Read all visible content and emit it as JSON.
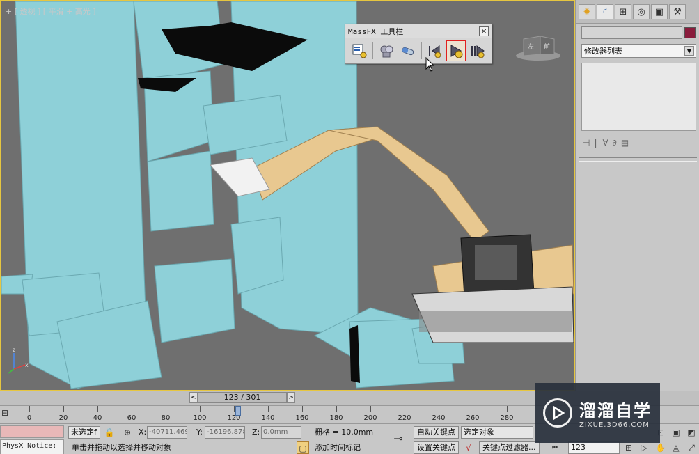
{
  "viewport": {
    "label": "+ [ 透视 ] [ 平滑 + 高光 ]"
  },
  "massfx": {
    "title": "MassFX 工具栏",
    "close": "×",
    "tools": [
      {
        "icon": "massfx-explorer-icon"
      },
      {
        "icon": "rigid-body-icon"
      },
      {
        "icon": "constraint-icon"
      },
      {
        "icon": "reset-simulation-icon"
      },
      {
        "icon": "start-simulation-icon",
        "active": true
      },
      {
        "icon": "step-simulation-icon"
      }
    ]
  },
  "viewcube": {
    "label": "左 前"
  },
  "cmdpanel": {
    "tabs": [
      "create-icon",
      "modify-icon",
      "hierarchy-icon",
      "motion-icon",
      "display-icon",
      "utilities-icon"
    ],
    "name_value": "",
    "color": "#8a1c3c",
    "modifier_list": "修改器列表"
  },
  "timeslider": {
    "value": "123 / 301",
    "prev": "<",
    "next": ">"
  },
  "trackbar": {
    "ticks": [
      "0",
      "20",
      "40",
      "60",
      "80",
      "100",
      "120",
      "140",
      "160",
      "180",
      "200",
      "220",
      "240",
      "260",
      "280"
    ]
  },
  "status": {
    "physx_notice": "PhysX Notice:",
    "selection": "未选定f",
    "x_label": "X:",
    "x_value": "-40711.469",
    "y_label": "Y:",
    "y_value": "-16196.878",
    "z_label": "Z:",
    "z_value": "0.0mm",
    "grid": "栅格 = 10.0mm",
    "prompt": "单击并拖动以选择并移动对象",
    "add_time_tag": "添加时间标记",
    "auto_key": "自动关键点",
    "set_key": "设置关键点",
    "selected_object": "选定对象",
    "key_filters": "关键点过滤器...",
    "frame": "123"
  },
  "watermark": {
    "name": "溜溜自学",
    "url": "ZIXUE.3D66.COM"
  }
}
